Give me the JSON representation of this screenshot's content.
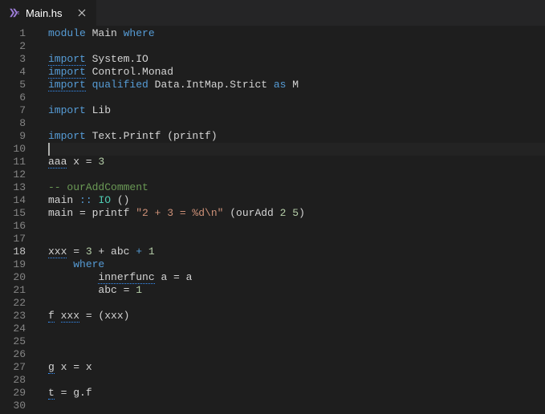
{
  "tab": {
    "filename": "Main.hs",
    "icon_name": "haskell-icon"
  },
  "editor": {
    "active_line": 18,
    "cursor_line": 10,
    "lines": [
      {
        "n": 1,
        "tokens": [
          {
            "t": "module ",
            "c": "kw"
          },
          {
            "t": "Main ",
            "c": "id"
          },
          {
            "t": "where",
            "c": "kw"
          }
        ]
      },
      {
        "n": 2,
        "tokens": []
      },
      {
        "n": 3,
        "tokens": [
          {
            "t": "import",
            "c": "kw",
            "d": "info"
          },
          {
            "t": " System.IO",
            "c": "id"
          }
        ]
      },
      {
        "n": 4,
        "tokens": [
          {
            "t": "import",
            "c": "kw",
            "d": "info"
          },
          {
            "t": " Control.Monad",
            "c": "id"
          }
        ]
      },
      {
        "n": 5,
        "tokens": [
          {
            "t": "import",
            "c": "kw",
            "d": "info"
          },
          {
            "t": " ",
            "c": ""
          },
          {
            "t": "qualified",
            "c": "kw"
          },
          {
            "t": " Data.IntMap.Strict ",
            "c": "id"
          },
          {
            "t": "as",
            "c": "kw"
          },
          {
            "t": " M",
            "c": "id"
          }
        ]
      },
      {
        "n": 6,
        "tokens": []
      },
      {
        "n": 7,
        "tokens": [
          {
            "t": "import",
            "c": "kw"
          },
          {
            "t": " Lib",
            "c": "id"
          }
        ]
      },
      {
        "n": 8,
        "tokens": []
      },
      {
        "n": 9,
        "tokens": [
          {
            "t": "import",
            "c": "kw"
          },
          {
            "t": " Text.Printf (printf)",
            "c": "id"
          }
        ]
      },
      {
        "n": 10,
        "tokens": [],
        "cursor": true
      },
      {
        "n": 11,
        "tokens": [
          {
            "t": "aaa",
            "c": "id",
            "d": "info"
          },
          {
            "t": " x = ",
            "c": "id"
          },
          {
            "t": "3",
            "c": "num"
          }
        ]
      },
      {
        "n": 12,
        "tokens": []
      },
      {
        "n": 13,
        "tokens": [
          {
            "t": "-- ourAddComment",
            "c": "cmt"
          }
        ]
      },
      {
        "n": 14,
        "tokens": [
          {
            "t": "main ",
            "c": "id"
          },
          {
            "t": "::",
            "c": "kw"
          },
          {
            "t": " ",
            "c": ""
          },
          {
            "t": "IO",
            "c": "type"
          },
          {
            "t": " ()",
            "c": "id"
          }
        ]
      },
      {
        "n": 15,
        "tokens": [
          {
            "t": "main = printf ",
            "c": "id"
          },
          {
            "t": "\"2 + 3 = %d\\n\"",
            "c": "str"
          },
          {
            "t": " (ourAdd ",
            "c": "id"
          },
          {
            "t": "2",
            "c": "num"
          },
          {
            "t": " ",
            "c": ""
          },
          {
            "t": "5",
            "c": "num"
          },
          {
            "t": ")",
            "c": "id"
          }
        ]
      },
      {
        "n": 16,
        "tokens": []
      },
      {
        "n": 17,
        "tokens": []
      },
      {
        "n": 18,
        "tokens": [
          {
            "t": "xxx",
            "c": "id",
            "d": "info"
          },
          {
            "t": " = ",
            "c": "id"
          },
          {
            "t": "3",
            "c": "num"
          },
          {
            "t": " + abc ",
            "c": "id"
          },
          {
            "t": "+",
            "c": "kw"
          },
          {
            "t": " ",
            "c": ""
          },
          {
            "t": "1",
            "c": "num"
          }
        ]
      },
      {
        "n": 19,
        "tokens": [
          {
            "t": "    ",
            "c": ""
          },
          {
            "t": "where",
            "c": "kw"
          }
        ]
      },
      {
        "n": 20,
        "tokens": [
          {
            "t": "        ",
            "c": ""
          },
          {
            "t": "innerfunc",
            "c": "id",
            "d": "info"
          },
          {
            "t": " a = a",
            "c": "id"
          }
        ]
      },
      {
        "n": 21,
        "tokens": [
          {
            "t": "        abc = ",
            "c": "id"
          },
          {
            "t": "1",
            "c": "num"
          }
        ]
      },
      {
        "n": 22,
        "tokens": []
      },
      {
        "n": 23,
        "tokens": [
          {
            "t": "f",
            "c": "id",
            "d": "info"
          },
          {
            "t": " ",
            "c": ""
          },
          {
            "t": "xxx",
            "c": "id",
            "d": "info"
          },
          {
            "t": " = (xxx)",
            "c": "id"
          }
        ]
      },
      {
        "n": 24,
        "tokens": []
      },
      {
        "n": 25,
        "tokens": []
      },
      {
        "n": 26,
        "tokens": []
      },
      {
        "n": 27,
        "tokens": [
          {
            "t": "g",
            "c": "id",
            "d": "info"
          },
          {
            "t": " x = x",
            "c": "id"
          }
        ]
      },
      {
        "n": 28,
        "tokens": []
      },
      {
        "n": 29,
        "tokens": [
          {
            "t": "t",
            "c": "id",
            "d": "info"
          },
          {
            "t": " = g.f",
            "c": "id"
          }
        ]
      },
      {
        "n": 30,
        "tokens": []
      }
    ]
  }
}
